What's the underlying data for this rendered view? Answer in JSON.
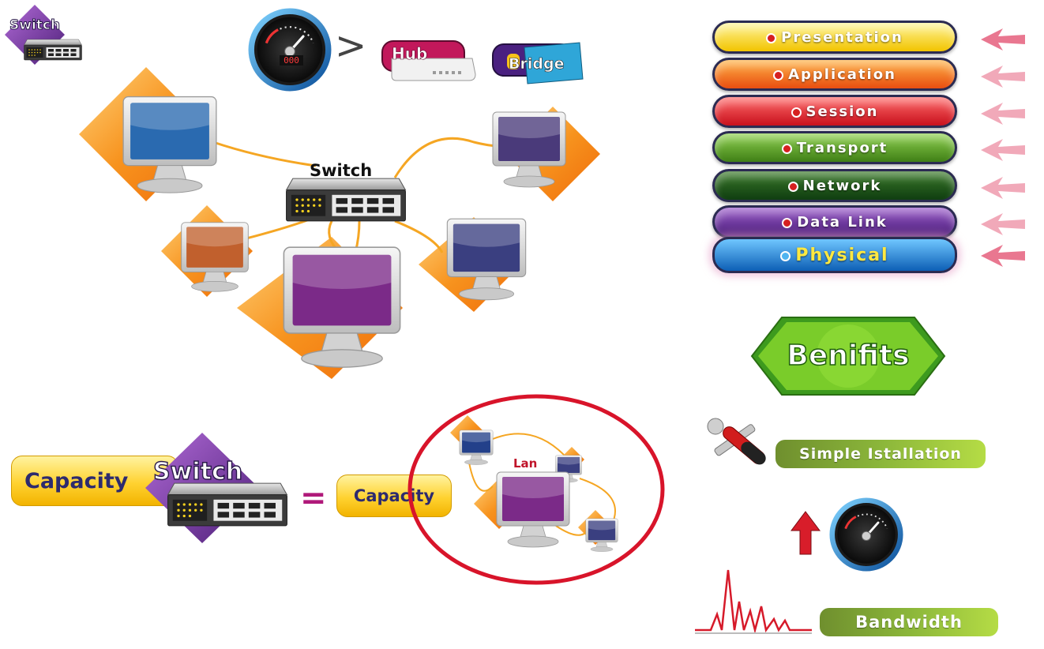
{
  "labels": {
    "switch_corner": "Switch",
    "hub": "Hub",
    "bridge": "Bridge",
    "meter_readout": "000",
    "switch_center": "Switch",
    "capacity_left": "Capacity",
    "switch_bottom": "Switch",
    "equals": "=",
    "capacity_right": "Capacity",
    "lan": "Lan",
    "benefits": "Benifits",
    "simple_installation": "Simple Istallation",
    "bandwidth": "Bandwidth",
    "greater_than": ">"
  },
  "osi_layers": [
    {
      "label": "Presentation",
      "color_top": "#fff59a",
      "color_bottom": "#f2c400",
      "text_color": "#ffffff"
    },
    {
      "label": "Application",
      "color_top": "#ffb347",
      "color_bottom": "#e84d10",
      "text_color": "#ffffff"
    },
    {
      "label": "Session",
      "color_top": "#ff6b6b",
      "color_bottom": "#c8101c",
      "text_color": "#ffffff"
    },
    {
      "label": "Transport",
      "color_top": "#8fd14f",
      "color_bottom": "#3f7f16",
      "text_color": "#ffffff"
    },
    {
      "label": "Network",
      "color_top": "#3b7a2a",
      "color_bottom": "#0f3d10",
      "text_color": "#ffffff"
    },
    {
      "label": "Data Link",
      "color_top": "#9a5bc9",
      "color_bottom": "#4a1e7a",
      "text_color": "#ffffff"
    },
    {
      "label": "Physical",
      "color_top": "#6fc6ff",
      "color_bottom": "#0d5fb5",
      "text_color": "#ffe840"
    }
  ],
  "colors": {
    "cable": "#f5a623",
    "diamond_orange": "#f7931e",
    "lan_circle": "#d8142a",
    "purple": "#6a2c91",
    "benefits_green": "#5fb82e"
  },
  "icons": [
    "speedometer-icon",
    "hub-icon",
    "bridge-icon",
    "switch-icon",
    "monitor-icon",
    "tools-icon",
    "up-arrow-icon",
    "bandwidth-spikes-icon"
  ]
}
